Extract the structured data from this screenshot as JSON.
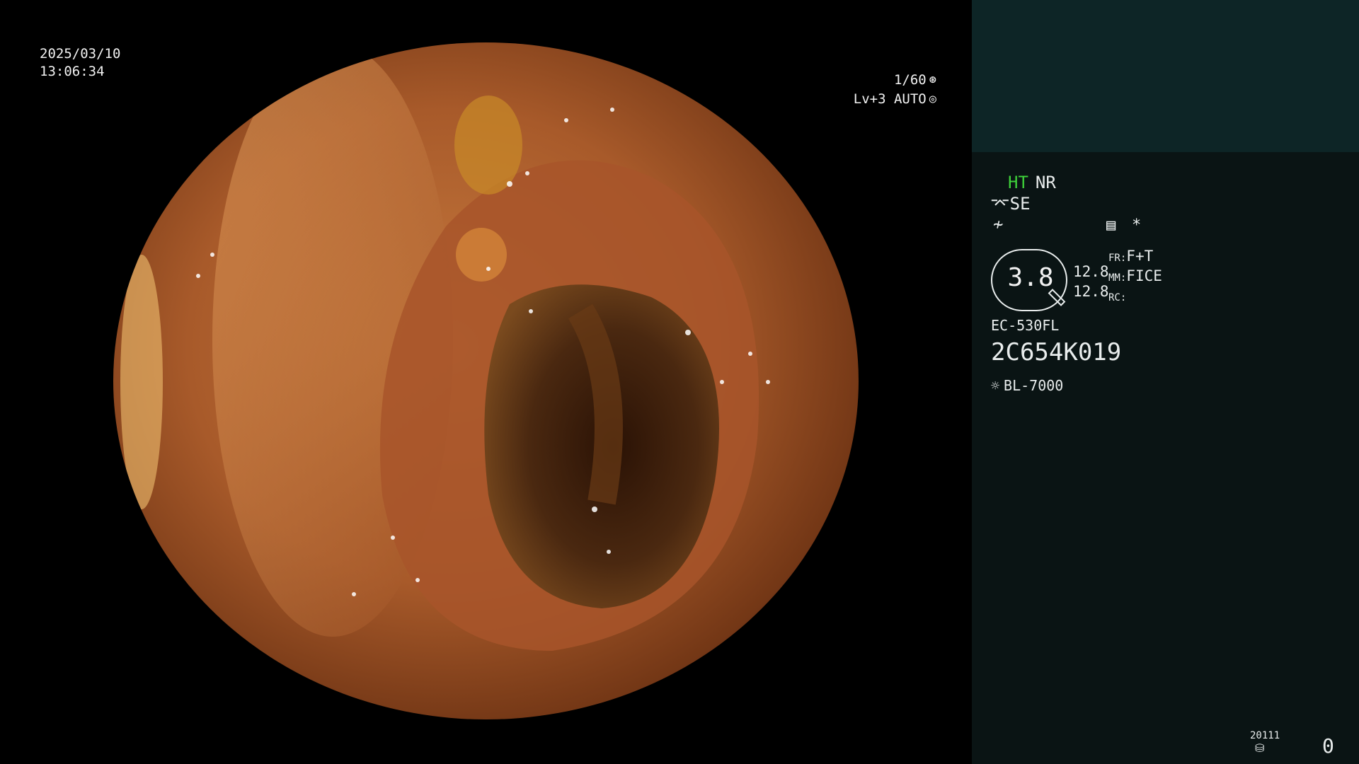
{
  "overlay": {
    "date": "2025/03/10",
    "time": "13:06:34",
    "shutter": "1/60",
    "level": "Lv+3 AUTO"
  },
  "panel": {
    "ht": "HT",
    "nr": "NR",
    "se": "SE",
    "gauge_value": "3.8",
    "val_1": "12.8",
    "val_2": "12.8",
    "fr_label": "FR:",
    "fr_value": "F+T",
    "mm_label": "MM:",
    "mm_value": "FICE",
    "rc_label": "RC:",
    "scope_model": "EC-530FL",
    "serial": "2C654K019",
    "lamp": "BL-7000",
    "code": "20111",
    "count": "0"
  },
  "colors": {
    "panel_bg": "#0a1414",
    "panel_top_bg": "#0d2526",
    "ht_green": "#3ed13a"
  },
  "icons": [
    "shutter-icon",
    "iris-icon",
    "structure-enhance-icon",
    "noise-icon",
    "memo-icon",
    "star-icon",
    "gauge-needle-icon",
    "lamp-icon",
    "disk-icon"
  ]
}
